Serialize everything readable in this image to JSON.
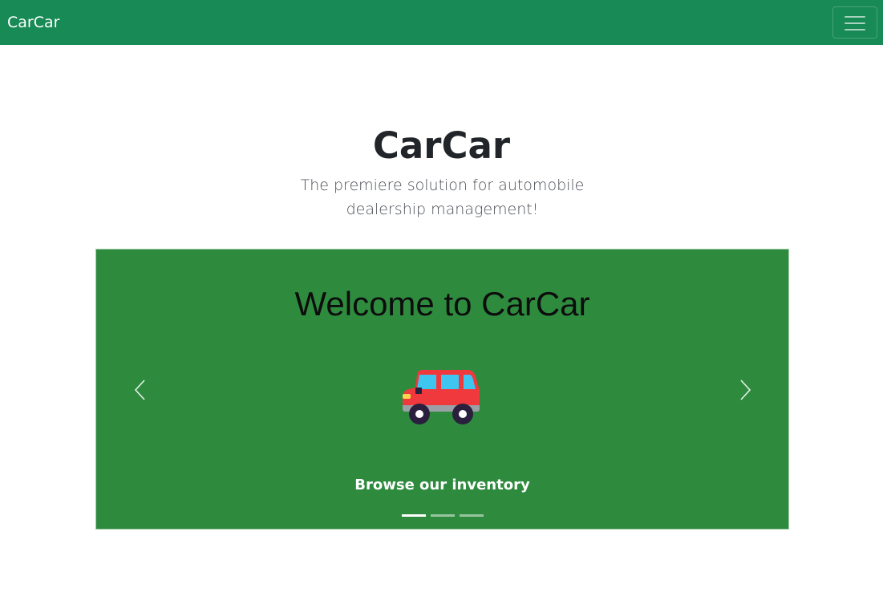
{
  "navbar": {
    "brand": "CarCar",
    "toggler_icon": "hamburger-menu-icon",
    "background": "#178a55"
  },
  "hero": {
    "title": "CarCar",
    "lead": "The premiere solution for automobile dealership management!"
  },
  "carousel": {
    "background": "#2e8b3e",
    "active_slide": 0,
    "slides": [
      {
        "heading": "Welcome to CarCar",
        "image_icon": "red-car-icon",
        "caption": "Browse our inventory"
      }
    ],
    "indicator_count": 3,
    "prev_icon": "chevron-left-icon",
    "next_icon": "chevron-right-icon"
  }
}
